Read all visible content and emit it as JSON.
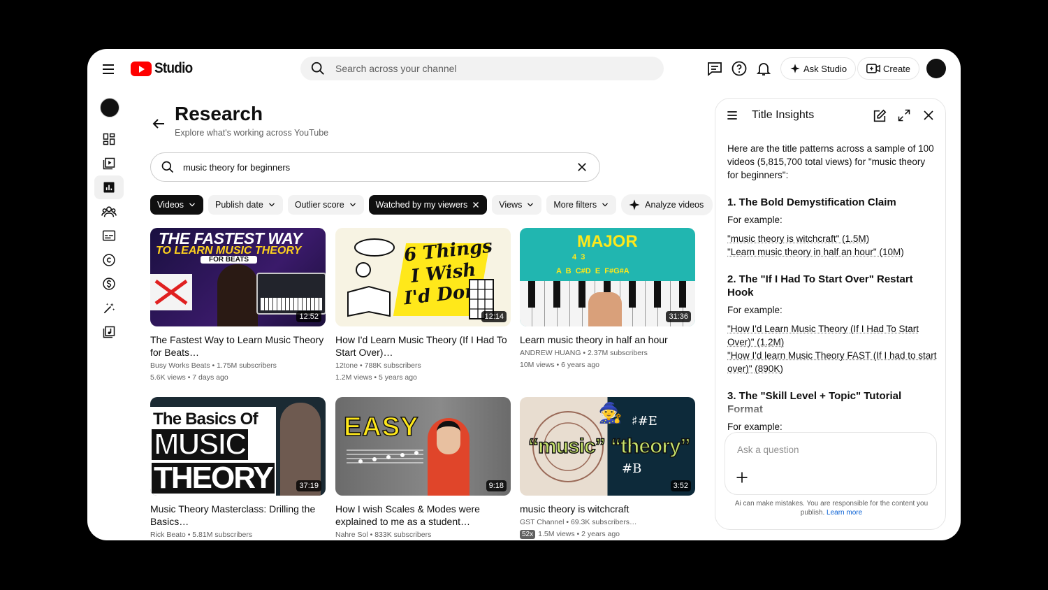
{
  "header": {
    "app_name": "Studio",
    "search_placeholder": "Search across your channel",
    "ask_studio_label": "Ask Studio",
    "create_label": "Create"
  },
  "sidebar": {
    "items": [
      "dashboard-icon",
      "content-icon",
      "analytics-icon",
      "community-icon",
      "subtitles-icon",
      "copyright-icon",
      "earn-icon",
      "customization-icon",
      "audio-library-icon"
    ],
    "active": "analytics-icon"
  },
  "research": {
    "title": "Research",
    "subtitle": "Explore what's working across YouTube",
    "query": "music theory for beginners",
    "chips": [
      "Videos",
      "Publish date",
      "Outlier score",
      "Watched by my viewers",
      "Views",
      "More filters"
    ],
    "analyze_label": "Analyze videos"
  },
  "videos": [
    {
      "title": "The Fastest Way to Learn Music Theory for Beats…",
      "channel": "Busy Works Beats",
      "subs": "1.75M subscribers",
      "views": "5.6K views",
      "age": "7 days ago",
      "duration": "12:52",
      "thumb_lines": [
        "THE FASTEST WAY",
        "TO LEARN MUSIC THEORY",
        "FOR BEATS"
      ]
    },
    {
      "title": "How I'd Learn Music Theory (If I Had To Start Over)…",
      "channel": "12tone",
      "subs": "788K subscribers",
      "views": "1.2M views",
      "age": "5 years ago",
      "duration": "12:14",
      "thumb_lines": [
        "6 Things",
        "I Wish",
        "I'd Done"
      ]
    },
    {
      "title": "Learn music theory in half an hour",
      "channel": "ANDREW HUANG",
      "subs": "2.37M subscribers",
      "views": "10M views",
      "age": "6 years ago",
      "duration": "31:36",
      "thumb_lines": [
        "MAJOR",
        "A  B  C#D  E  F#G#A",
        "4  3"
      ]
    },
    {
      "title": "Music Theory Masterclass: Drilling the Basics…",
      "channel": "Rick Beato",
      "subs": "5.81M subscribers",
      "views": "",
      "age": "",
      "duration": "37:19",
      "thumb_lines": [
        "The Basics Of",
        "MUSIC",
        "THEORY"
      ]
    },
    {
      "title": "How I wish Scales & Modes were explained to me as a student…",
      "channel": "Nahre Sol",
      "subs": "833K subscribers",
      "views": "",
      "age": "",
      "duration": "9:18",
      "thumb_lines": [
        "EASY"
      ]
    },
    {
      "title": "music theory is witchcraft",
      "channel": "GST Channel",
      "subs": "69.3K subscribers…",
      "views": "1.5M views",
      "age": "2 years ago",
      "duration": "3:52",
      "badge": "52x",
      "thumb_lines": [
        "“music”",
        "“theory”",
        "♯#E",
        "#B"
      ]
    }
  ],
  "panel": {
    "title": "Title Insights",
    "intro": "Here are the title patterns across a sample of 100 videos (5,815,700 total views) for \"music theory for beginners\":",
    "sections": [
      {
        "heading": "1. The Bold Demystification Claim",
        "label": "For example:",
        "examples": [
          "\"music theory is witchcraft\" (1.5M)",
          "\"Learn music theory in half an hour\" (10M)"
        ]
      },
      {
        "heading": "2. The \"If I Had To Start Over\" Restart Hook",
        "label": "For example:",
        "examples": [
          "\"How I'd Learn Music Theory (If I Had To Start Over)\" (1.2M)",
          "\"How I'd learn Music Theory FAST (If I had to start over)\" (890K)"
        ]
      },
      {
        "heading": "3. The \"Skill Level + Topic\" Tutorial Format",
        "label": "For example:",
        "examples": []
      }
    ],
    "ask_placeholder": "Ask a question",
    "disclaimer": "Ai can make mistakes. You are responsible for the content you publish.",
    "learn_more": "Learn more"
  }
}
